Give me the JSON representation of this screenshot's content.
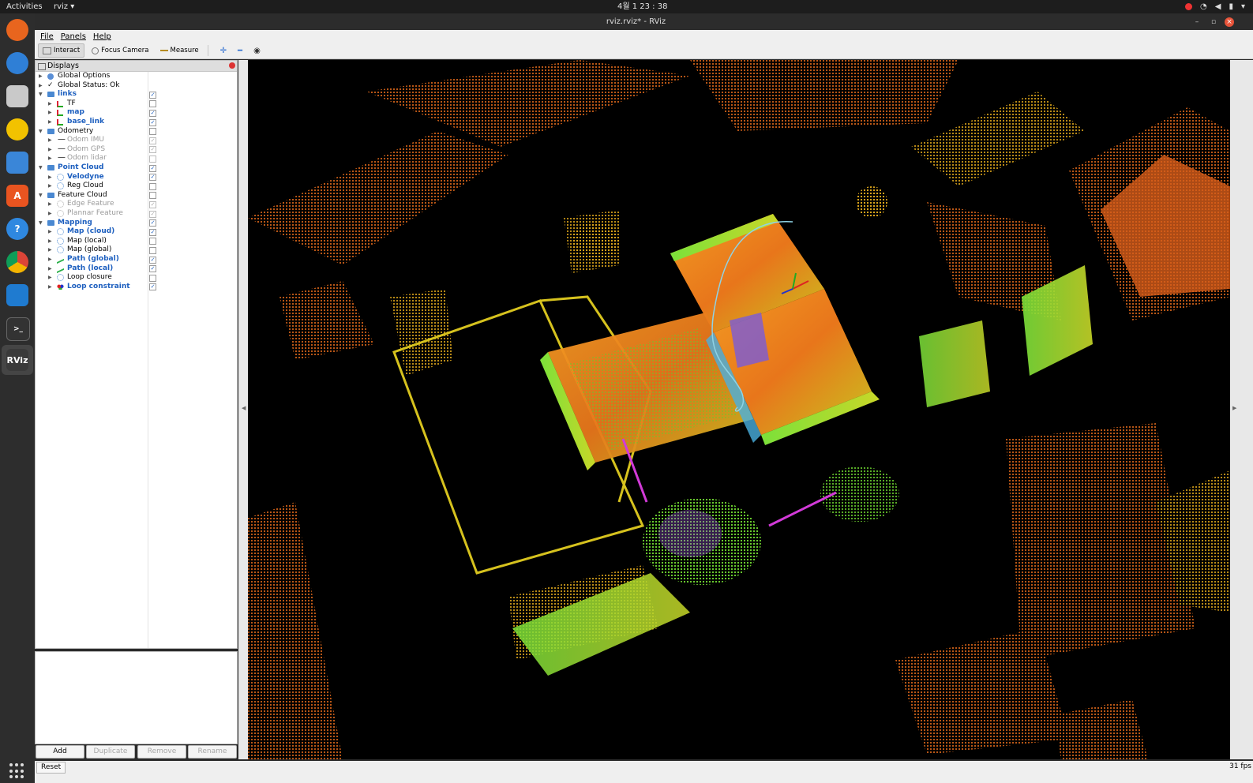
{
  "topbar": {
    "activities": "Activities",
    "app": "rviz",
    "clock": "4월 1 23 : 38"
  },
  "window": {
    "title": "rviz.rviz* - RViz"
  },
  "menu": {
    "file": "File",
    "panels": "Panels",
    "help": "Help"
  },
  "toolbar": {
    "interact": "Interact",
    "focus_camera": "Focus Camera",
    "measure": "Measure"
  },
  "displays": {
    "title": "Displays",
    "items": [
      {
        "label": "Global Options",
        "checked": null
      },
      {
        "label": "Global Status: Ok",
        "checked": null
      },
      {
        "label": "links",
        "checked": true
      },
      {
        "label": "TF",
        "checked": false
      },
      {
        "label": "map",
        "checked": true
      },
      {
        "label": "base_link",
        "checked": true
      },
      {
        "label": "Odometry",
        "checked": false
      },
      {
        "label": "Odom IMU",
        "checked": true
      },
      {
        "label": "Odom GPS",
        "checked": true
      },
      {
        "label": "Odom lidar",
        "checked": false
      },
      {
        "label": "Point Cloud",
        "checked": true
      },
      {
        "label": "Velodyne",
        "checked": true
      },
      {
        "label": "Reg Cloud",
        "checked": false
      },
      {
        "label": "Feature Cloud",
        "checked": false
      },
      {
        "label": "Edge Feature",
        "checked": true
      },
      {
        "label": "Plannar Feature",
        "checked": true
      },
      {
        "label": "Mapping",
        "checked": true
      },
      {
        "label": "Map (cloud)",
        "checked": true
      },
      {
        "label": "Map (local)",
        "checked": false
      },
      {
        "label": "Map (global)",
        "checked": false
      },
      {
        "label": "Path (global)",
        "checked": true
      },
      {
        "label": "Path (local)",
        "checked": true
      },
      {
        "label": "Loop closure",
        "checked": false
      },
      {
        "label": "Loop constraint",
        "checked": true
      }
    ]
  },
  "buttons": {
    "add": "Add",
    "duplicate": "Duplicate",
    "remove": "Remove",
    "rename": "Rename"
  },
  "status": {
    "reset": "Reset",
    "fps": "31 fps"
  },
  "colors": {
    "accent": "#1d5fbf",
    "cloud_orange": "#e8721c",
    "cloud_green": "#6ad12b",
    "path": "#8fd3e6"
  }
}
